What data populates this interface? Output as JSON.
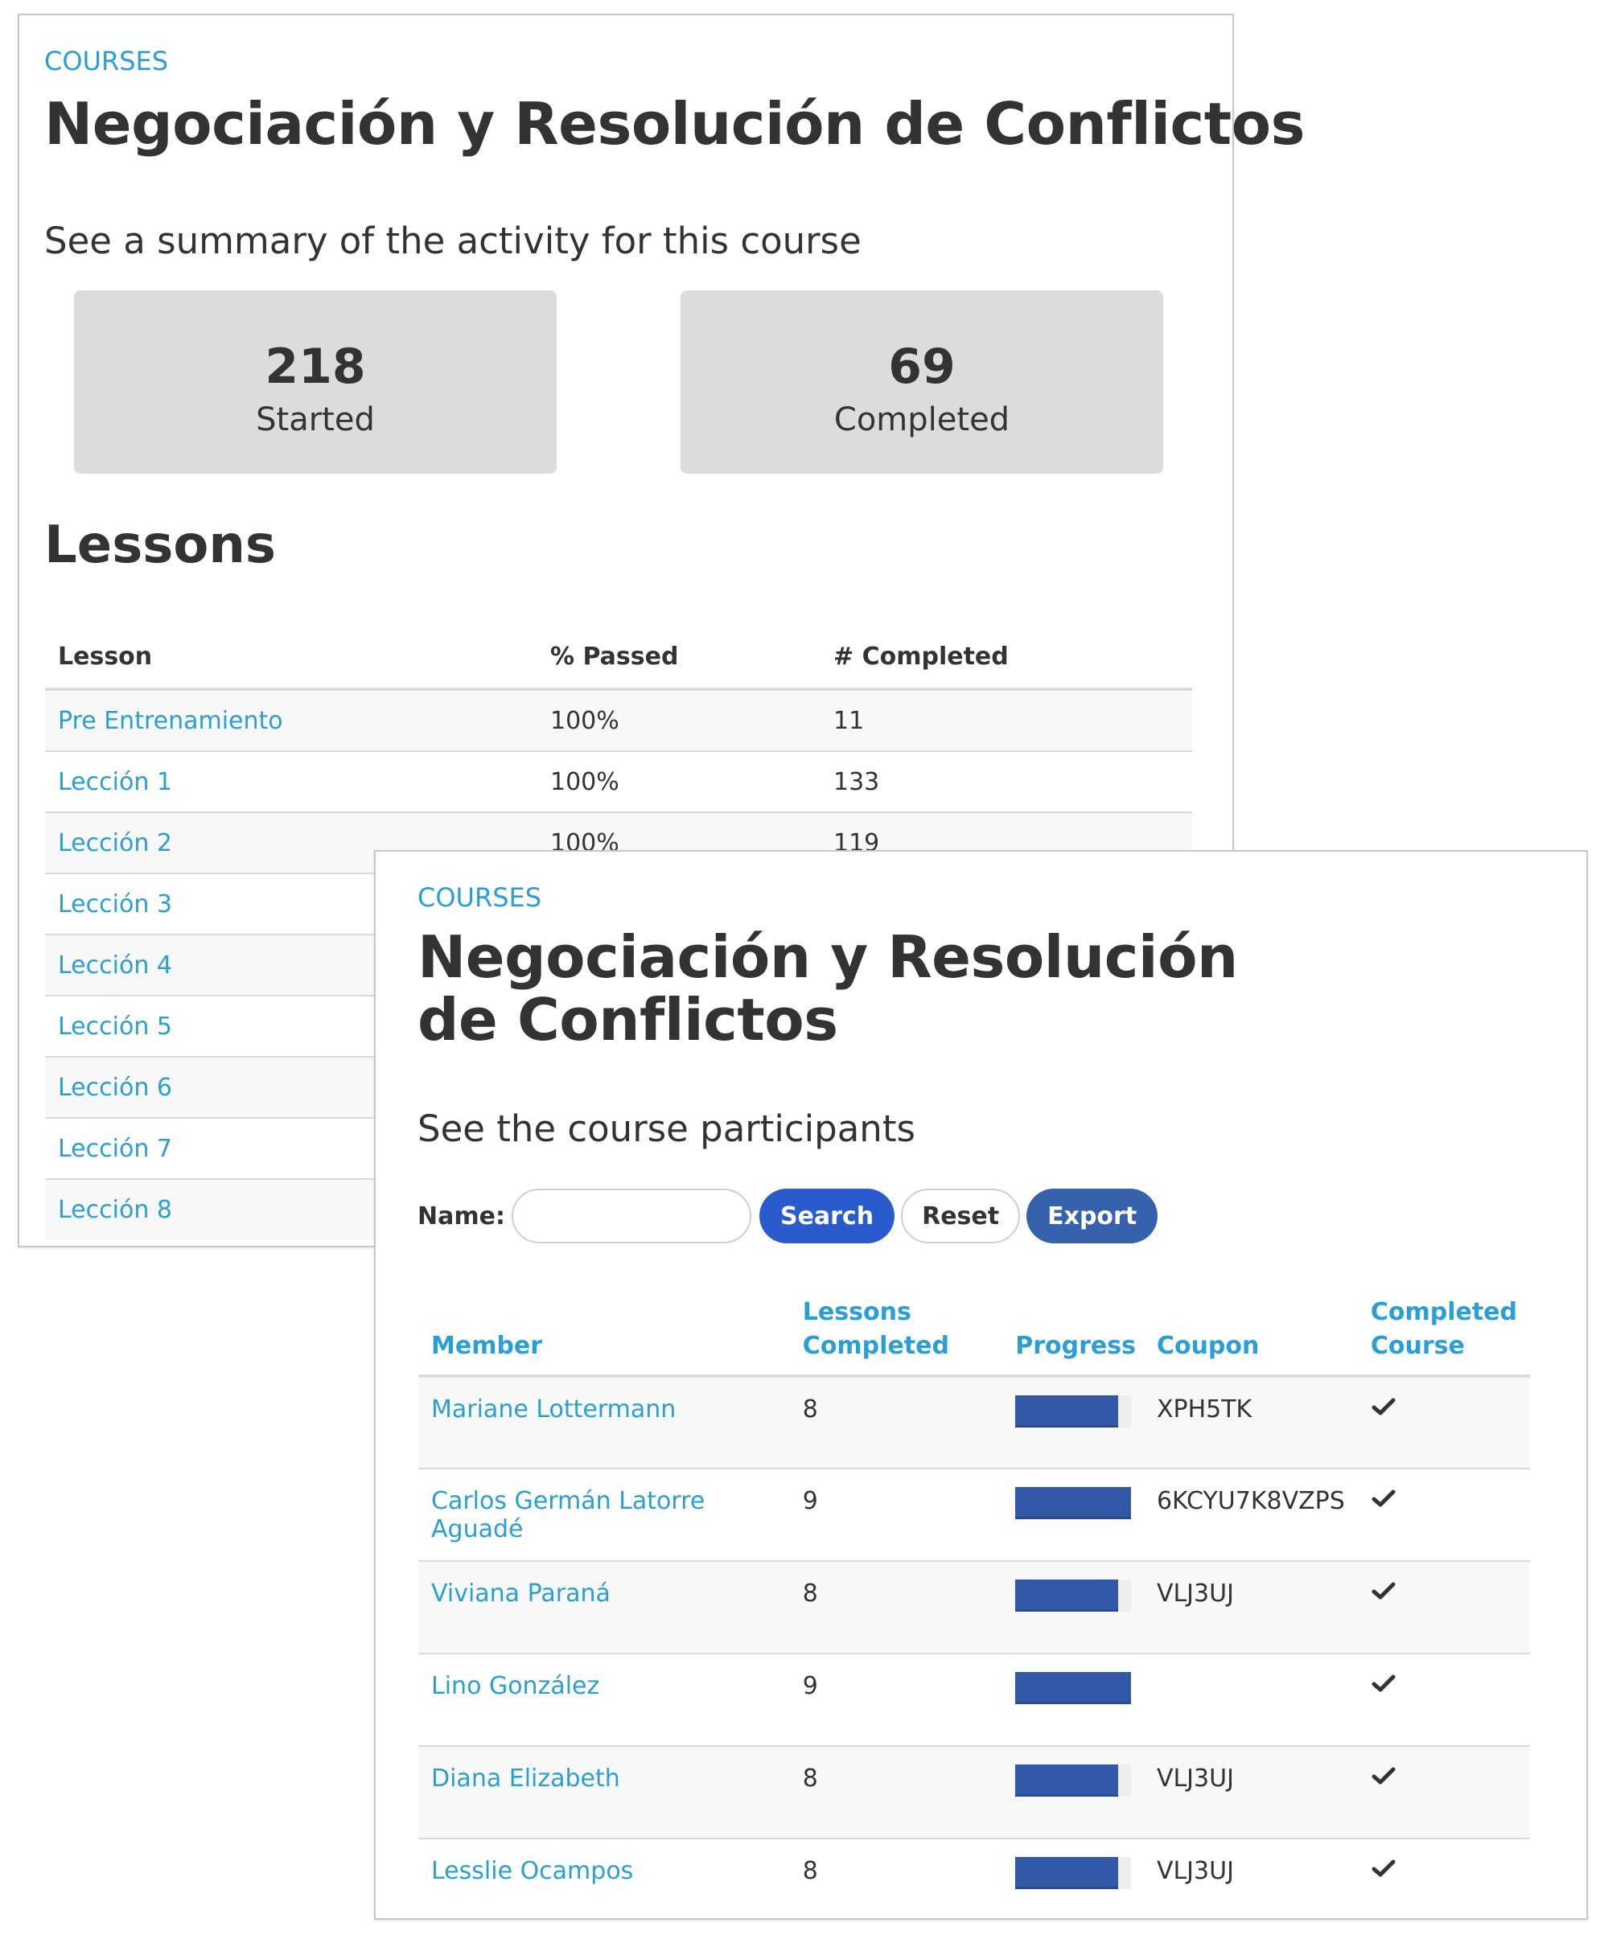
{
  "summary_panel": {
    "breadcrumb": "COURSES",
    "title": "Negociación y Resolución de Conflictos",
    "subtitle": "See a summary of the activity for this course",
    "stats": [
      {
        "value": "218",
        "label": "Started"
      },
      {
        "value": "69",
        "label": "Completed"
      }
    ],
    "lessons_heading": "Lessons",
    "lessons_table": {
      "headers": [
        "Lesson",
        "% Passed",
        "# Completed"
      ],
      "rows": [
        {
          "lesson": "Pre Entrenamiento",
          "passed": "100%",
          "completed": "11"
        },
        {
          "lesson": "Lección 1",
          "passed": "100%",
          "completed": "133"
        },
        {
          "lesson": "Lección 2",
          "passed": "100%",
          "completed": "119"
        },
        {
          "lesson": "Lección 3",
          "passed": "",
          "completed": ""
        },
        {
          "lesson": "Lección 4",
          "passed": "",
          "completed": ""
        },
        {
          "lesson": "Lección 5",
          "passed": "",
          "completed": ""
        },
        {
          "lesson": "Lección 6",
          "passed": "",
          "completed": ""
        },
        {
          "lesson": "Lección 7",
          "passed": "",
          "completed": ""
        },
        {
          "lesson": "Lección 8",
          "passed": "",
          "completed": ""
        }
      ]
    }
  },
  "participants_panel": {
    "breadcrumb": "COURSES",
    "title": "Negociación y Resolución de Conflictos",
    "subtitle": "See the course participants",
    "filter": {
      "name_label": "Name:",
      "name_value": "",
      "name_placeholder": "",
      "search_label": "Search",
      "reset_label": "Reset",
      "export_label": "Export"
    },
    "table": {
      "headers": {
        "member": "Member",
        "lessons_completed_line1": "Lessons",
        "lessons_completed_line2": "Completed",
        "progress": "Progress",
        "coupon": "Coupon",
        "completed_course_line1": "Completed",
        "completed_course_line2": "Course"
      },
      "rows": [
        {
          "member": "Mariane Lottermann",
          "lessons_completed": "8",
          "progress_pct": 89,
          "coupon": "XPH5TK",
          "completed_course": true
        },
        {
          "member": "Carlos Germán Latorre Aguadé",
          "lessons_completed": "9",
          "progress_pct": 100,
          "coupon": "6KCYU7K8VZPS",
          "completed_course": true
        },
        {
          "member": "Viviana Paraná",
          "lessons_completed": "8",
          "progress_pct": 89,
          "coupon": "VLJ3UJ",
          "completed_course": true
        },
        {
          "member": "Lino González",
          "lessons_completed": "9",
          "progress_pct": 100,
          "coupon": "",
          "completed_course": true
        },
        {
          "member": "Diana Elizabeth",
          "lessons_completed": "8",
          "progress_pct": 89,
          "coupon": "VLJ3UJ",
          "completed_course": true
        },
        {
          "member": "Lesslie Ocampos",
          "lessons_completed": "8",
          "progress_pct": 89,
          "coupon": "VLJ3UJ",
          "completed_course": true
        }
      ]
    }
  },
  "colors": {
    "link": "#2a9fd6",
    "search_button": "#2a5bcc",
    "export_button": "#3561ad",
    "progress_fill": "#3159a8",
    "stat_box": "#dcdcdc"
  }
}
